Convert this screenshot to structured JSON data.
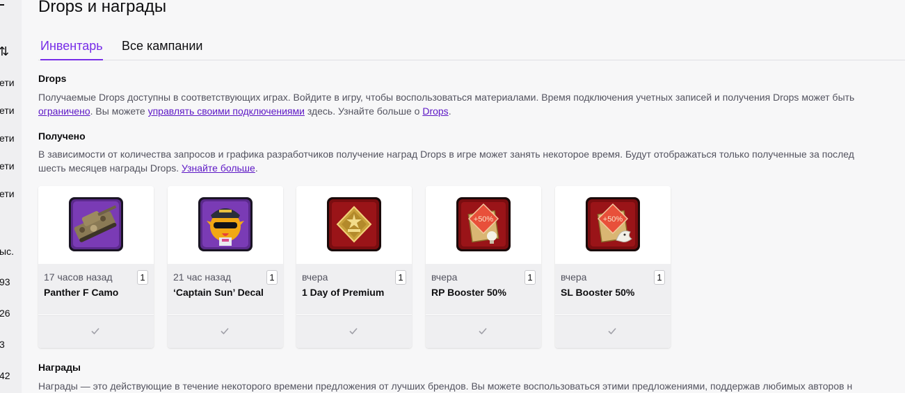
{
  "sidebar": {
    "items": [
      "ети",
      "ети",
      "ети",
      "ети",
      "ети",
      "ыс.",
      "93",
      "26",
      "3",
      "42"
    ]
  },
  "page": {
    "title": "Drops и награды"
  },
  "tabs": [
    {
      "label": "Инвентарь",
      "active": true
    },
    {
      "label": "Все кампании",
      "active": false
    }
  ],
  "drops_section": {
    "heading": "Drops",
    "line1": "Получаемые Drops доступны в соответствующих играх. Войдите в игру, чтобы воспользоваться материалами. Время подключения учетных записей и получения Drops может быть",
    "link_limited": "ограничено",
    "text_a": ". Вы можете ",
    "link_manage": "управлять своими подключениями",
    "text_b": " здесь. Узнайте больше о ",
    "link_drops": "Drops",
    "text_c": "."
  },
  "received_section": {
    "heading": "Получено",
    "line1": "В зависимости от количества запросов и графика разработчиков получение наград Drops в игре может занять некоторое время. Будут отображаться только полученные за послед",
    "text_a": "шесть месяцев награды Drops. ",
    "link_learn": "Узнайте больше",
    "text_b": "."
  },
  "cards": [
    {
      "time": "17 часов назад",
      "qty": "1",
      "name": "Panther F Camo",
      "icon": "tank-camo-icon"
    },
    {
      "time": "21 час назад",
      "qty": "1",
      "name": "‘Captain Sun’ Decal",
      "icon": "captain-sun-decal-icon"
    },
    {
      "time": "вчера",
      "qty": "1",
      "name": "1 Day of Premium",
      "icon": "premium-emblem-icon"
    },
    {
      "time": "вчера",
      "qty": "1",
      "name": "RP Booster 50%",
      "icon": "rp-booster-icon",
      "badge": "+50%"
    },
    {
      "time": "вчера",
      "qty": "1",
      "name": "SL Booster 50%",
      "icon": "sl-booster-icon",
      "badge": "+50%"
    }
  ],
  "rewards_section": {
    "heading": "Награды",
    "line1": "Награды — это действующие в течение некоторого времени предложения от лучших брендов. Вы можете воспользоваться этими предложениями, поддержав любимых авторов н"
  },
  "colors": {
    "accent": "#772ce8",
    "link": "#5c16c5",
    "card_info_bg": "#efeff1",
    "page_bg": "#f7f7f8"
  }
}
